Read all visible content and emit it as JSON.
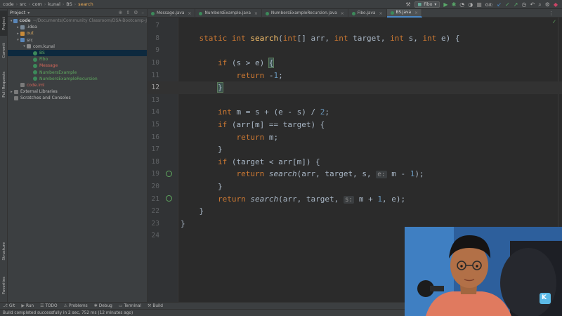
{
  "breadcrumbs": [
    "code",
    "src",
    "com",
    "kunal",
    "BS",
    "search"
  ],
  "run_config": "Fibo",
  "git_label": "Git:",
  "side_tabs": [
    "Project",
    "Commit",
    "Pull Requests",
    "Structure",
    "Favorites"
  ],
  "project": {
    "title": "Project",
    "tree": [
      {
        "label": "code",
        "hint": "~/Documents/Community Classroom/DSA-Bootcamp-J",
        "indent": 0,
        "arrow": "▾",
        "icon": "folder-blue",
        "bold": true
      },
      {
        "label": ".idea",
        "indent": 1,
        "arrow": "▸",
        "icon": "folder"
      },
      {
        "label": "out",
        "indent": 1,
        "arrow": "▸",
        "icon": "folder-orange",
        "color": "t-orange"
      },
      {
        "label": "src",
        "indent": 1,
        "arrow": "▾",
        "icon": "folder-blue"
      },
      {
        "label": "com.kunal",
        "indent": 2,
        "arrow": "▾",
        "icon": "pkg"
      },
      {
        "label": "BS",
        "indent": 3,
        "arrow": "",
        "icon": "cls",
        "color": "t-green",
        "selected": true
      },
      {
        "label": "Fibo",
        "indent": 3,
        "arrow": "",
        "icon": "cls",
        "color": "t-green"
      },
      {
        "label": "Message",
        "indent": 3,
        "arrow": "",
        "icon": "cls",
        "color": "t-red"
      },
      {
        "label": "NumbersExample",
        "indent": 3,
        "arrow": "",
        "icon": "cls",
        "color": "t-green"
      },
      {
        "label": "NumbersExampleRecursion",
        "indent": 3,
        "arrow": "",
        "icon": "cls",
        "color": "t-green"
      },
      {
        "label": "code.iml",
        "indent": 1,
        "arrow": "",
        "icon": "lib",
        "color": "t-red"
      },
      {
        "label": "External Libraries",
        "indent": 0,
        "arrow": "▸",
        "icon": "lib"
      },
      {
        "label": "Scratches and Consoles",
        "indent": 0,
        "arrow": "",
        "icon": "lib"
      }
    ]
  },
  "tabs": [
    {
      "label": "Message.java",
      "active": false
    },
    {
      "label": "NumbersExample.java",
      "active": false
    },
    {
      "label": "NumbersExampleRecursion.java",
      "active": false
    },
    {
      "label": "Fibo.java",
      "active": false
    },
    {
      "label": "BS.java",
      "active": true
    }
  ],
  "editor": {
    "current_line": 12,
    "lines": [
      {
        "n": "7",
        "html": ""
      },
      {
        "n": "8",
        "html": "    <span class='kw'>static int</span> <span class='fn'>search</span>(<span class='kw'>int</span>[] arr, <span class='kw'>int</span> target, <span class='kw'>int</span> s, <span class='kw'>int</span> e) {"
      },
      {
        "n": "9",
        "html": ""
      },
      {
        "n": "10",
        "html": "        <span class='kw'>if</span> (s &gt; e) <span class='brace-match'>{</span>"
      },
      {
        "n": "11",
        "html": "            <span class='kw'>return</span> -<span class='num'>1</span>;"
      },
      {
        "n": "12",
        "html": "        <span class='brace-match'>}</span>"
      },
      {
        "n": "13",
        "html": ""
      },
      {
        "n": "14",
        "html": "        <span class='kw'>int</span> m = s + (e - s) / <span class='num'>2</span>;"
      },
      {
        "n": "15",
        "html": "        <span class='kw'>if</span> (arr[m] == target) {"
      },
      {
        "n": "16",
        "html": "            <span class='kw'>return</span> m;"
      },
      {
        "n": "17",
        "html": "        }"
      },
      {
        "n": "18",
        "html": "        <span class='kw'>if</span> (target &lt; arr[m]) {"
      },
      {
        "n": "19",
        "html": "            <span class='kw'>return</span> <span class='it'>search</span>(arr, target, s, <span class='hint'>e:</span> m - <span class='num'>1</span>);"
      },
      {
        "n": "20",
        "html": "        }"
      },
      {
        "n": "21",
        "html": "        <span class='kw'>return</span> <span class='it'>search</span>(arr, target, <span class='hint'>s:</span> m + <span class='num'>1</span>, e);"
      },
      {
        "n": "22",
        "html": "    }"
      },
      {
        "n": "23",
        "html": "}"
      },
      {
        "n": "24",
        "html": ""
      }
    ],
    "recursion_lines": [
      "19",
      "21"
    ]
  },
  "bottom_tools": [
    "Git",
    "Run",
    "TODO",
    "Problems",
    "Debug",
    "Terminal",
    "Build"
  ],
  "status": "Build completed successfully in 2 sec, 752 ms (12 minutes ago)"
}
